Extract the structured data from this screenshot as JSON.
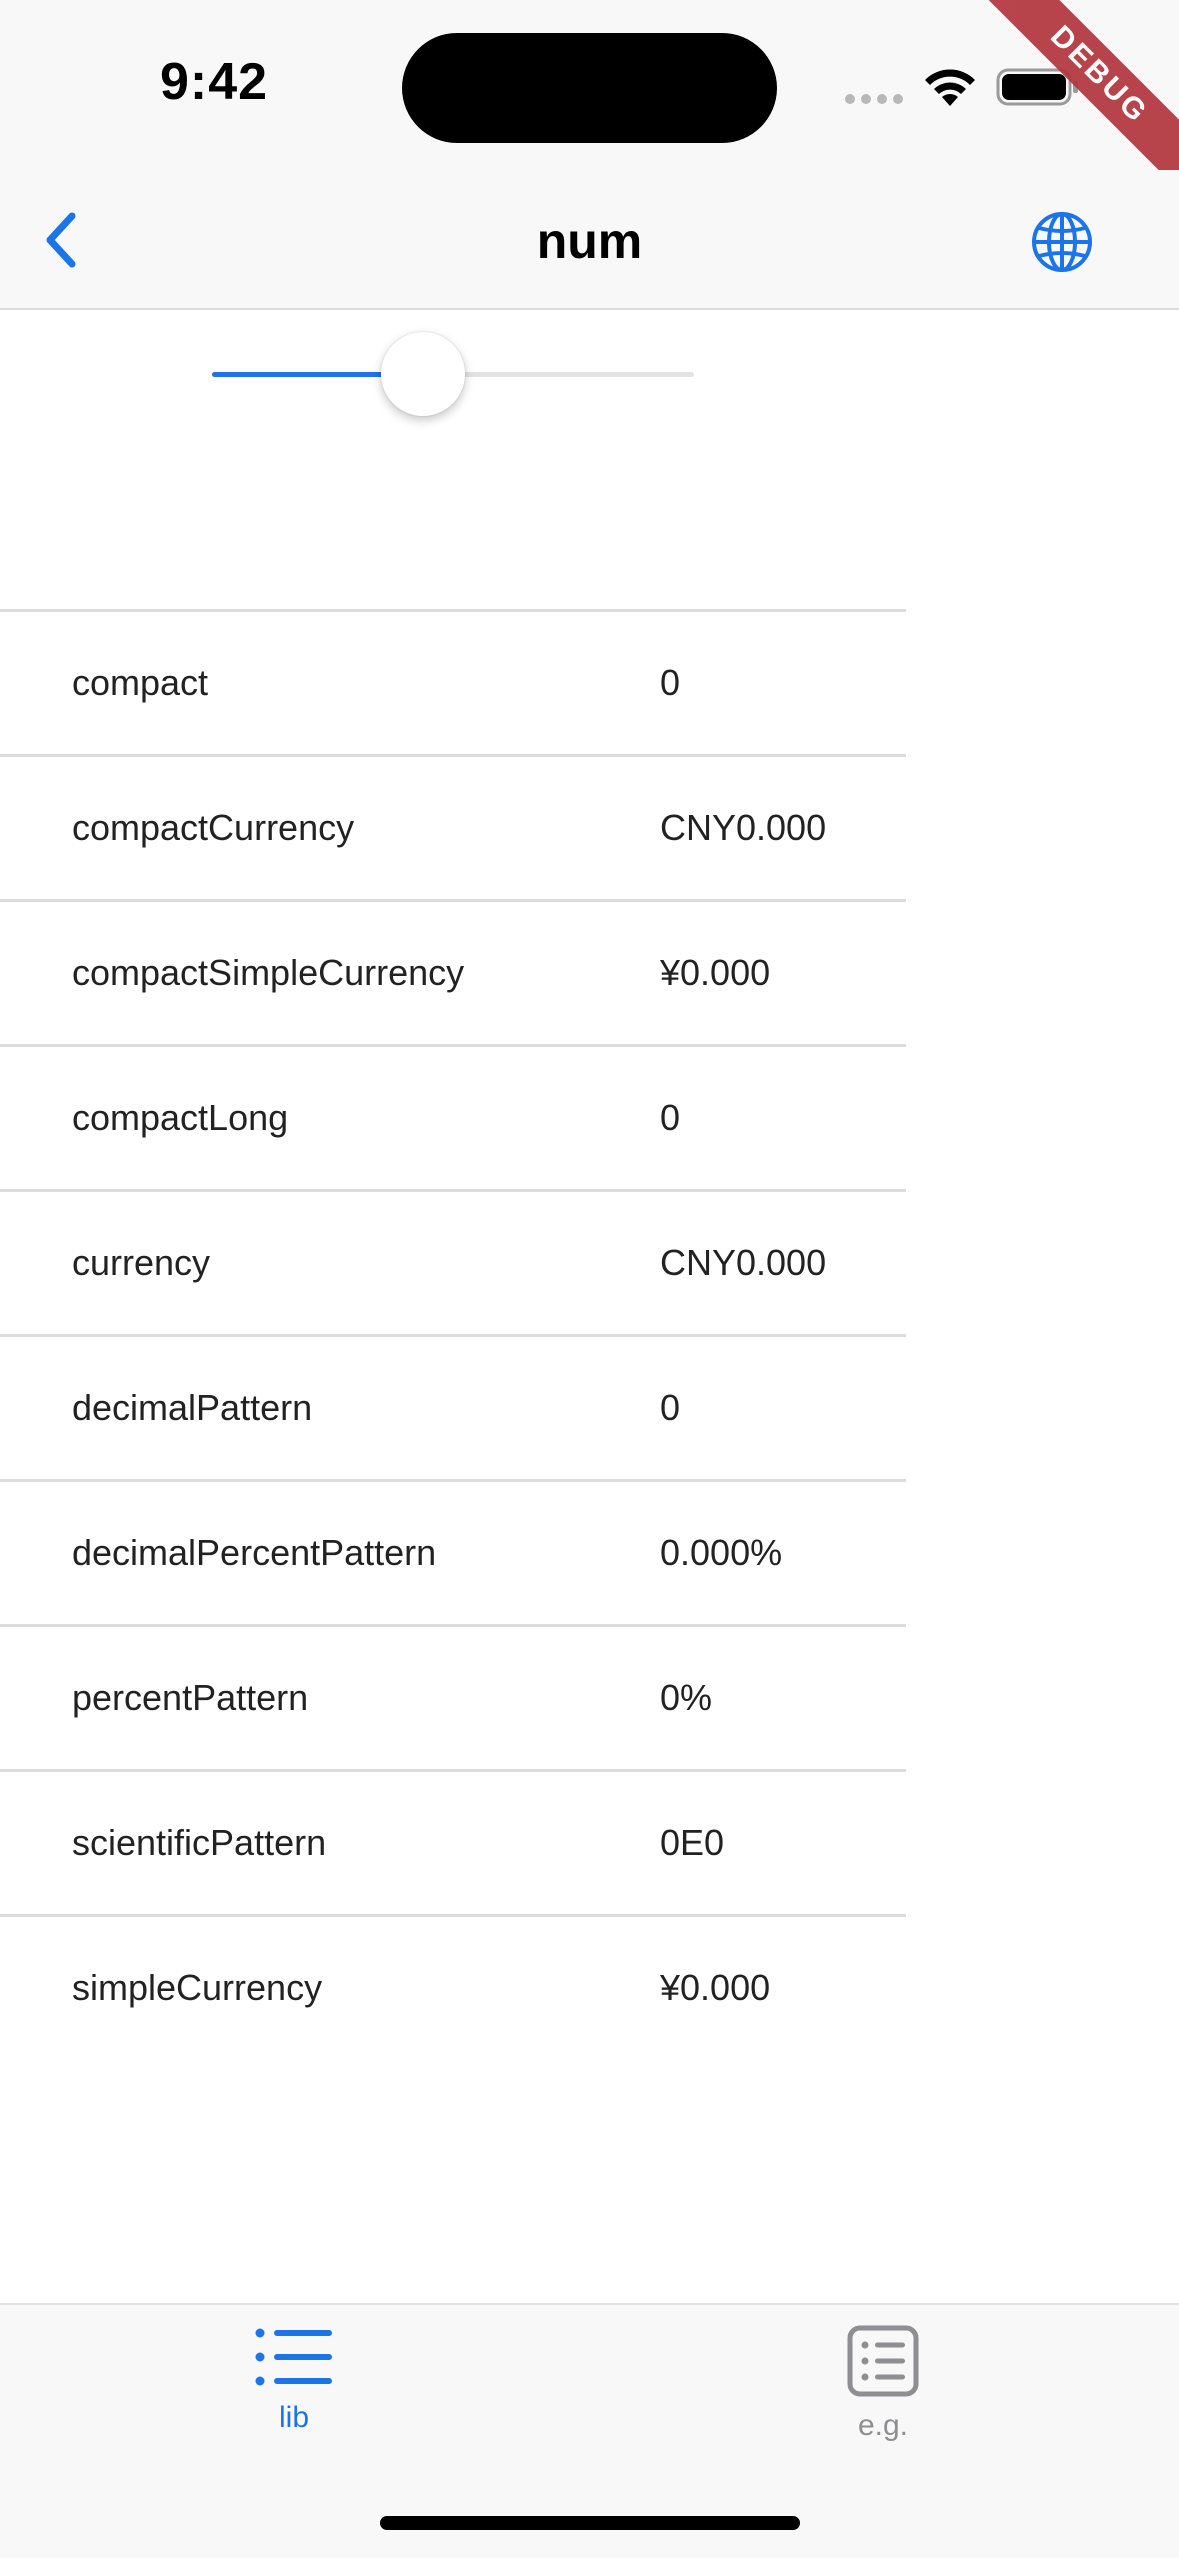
{
  "status_bar": {
    "time": "9:42"
  },
  "debug_banner": "DEBUG",
  "nav": {
    "title": "num",
    "back_icon": "chevron-left-icon",
    "action_icon": "globe-icon"
  },
  "accent_color": "#1c74e9",
  "slider": {
    "value_fraction": 0.5
  },
  "table": {
    "rows": [
      {
        "name": "compact",
        "value": "0"
      },
      {
        "name": "compactCurrency",
        "value": "CNY0.000"
      },
      {
        "name": "compactSimpleCurrency",
        "value": "¥0.000"
      },
      {
        "name": "compactLong",
        "value": "0"
      },
      {
        "name": "currency",
        "value": "CNY0.000"
      },
      {
        "name": "decimalPattern",
        "value": "0"
      },
      {
        "name": "decimalPercentPattern",
        "value": "0.000%"
      },
      {
        "name": "percentPattern",
        "value": "0%"
      },
      {
        "name": "scientificPattern",
        "value": "0E0"
      },
      {
        "name": "simpleCurrency",
        "value": "¥0.000"
      }
    ]
  },
  "tab_bar": {
    "tabs": [
      {
        "label": "lib",
        "icon": "list-icon",
        "active": true
      },
      {
        "label": "e.g.",
        "icon": "list-box-icon",
        "active": false
      }
    ]
  }
}
